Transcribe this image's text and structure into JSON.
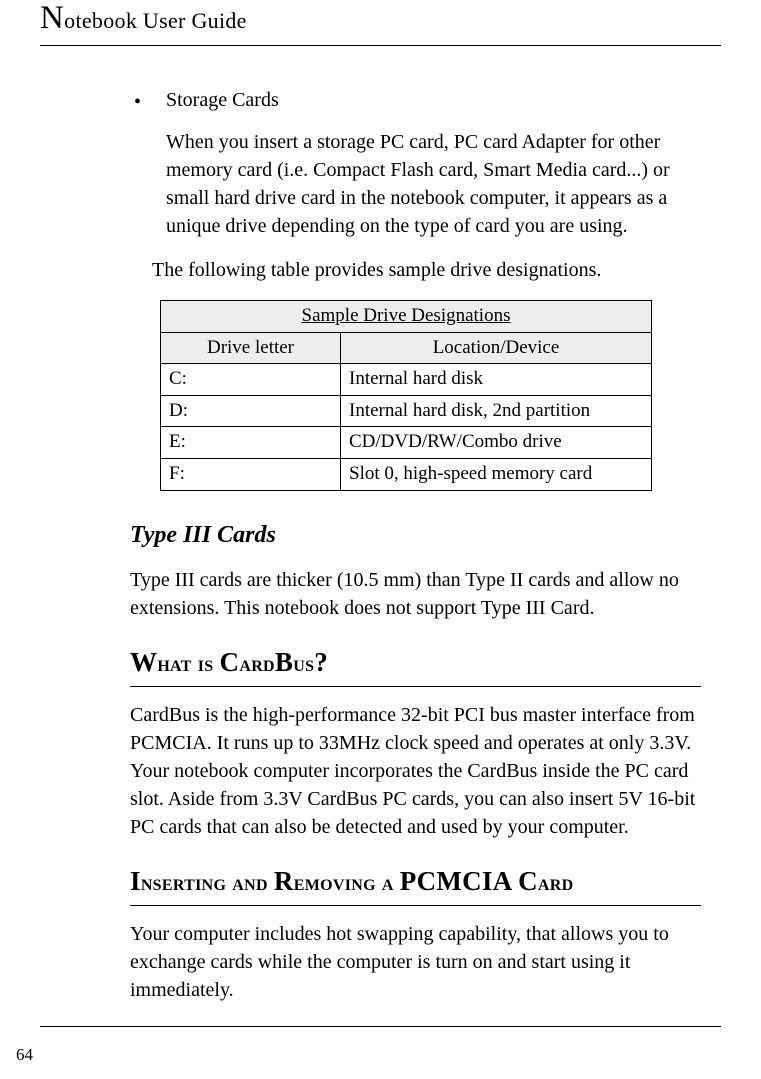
{
  "header": {
    "drop_cap": "N",
    "rest": "otebook User Guide"
  },
  "bullet": {
    "title": "Storage Cards",
    "paragraph": "When you insert a storage PC card, PC card Adapter for other memory card (i.e. Compact Flash card, Smart Media card...) or small hard drive card in the notebook computer, it appears as a unique drive depending on the type of card you are using."
  },
  "table_intro": "The following table provides sample drive designations.",
  "table": {
    "title": "Sample Drive Designations",
    "columns": [
      "Drive letter",
      "Location/Device"
    ],
    "rows": [
      {
        "letter": "C:",
        "device": "Internal hard disk"
      },
      {
        "letter": "D:",
        "device": "Internal hard disk, 2nd partition"
      },
      {
        "letter": "E:",
        "device": "CD/DVD/RW/Combo drive"
      },
      {
        "letter": "F:",
        "device": "Slot 0, high-speed memory card"
      }
    ]
  },
  "type3": {
    "heading": "Type III Cards",
    "paragraph": "Type III cards are thicker (10.5 mm) than Type II cards and allow no extensions. This notebook does not support Type III Card."
  },
  "cardbus": {
    "heading_parts": [
      "W",
      "hat is ",
      "C",
      "ard",
      "B",
      "us",
      "?"
    ],
    "paragraph": "CardBus is the high-performance 32-bit PCI bus master interface from PCMCIA. It runs up to 33MHz clock speed and operates at only 3.3V. Your notebook computer incorporates the CardBus inside the PC card slot. Aside from 3.3V CardBus PC cards, you can also insert 5V 16-bit PC cards that can also be detected and used by your computer."
  },
  "insert": {
    "heading_parts": [
      "I",
      "nserting and ",
      "R",
      "emoving a ",
      "PCMCIA C",
      "ard"
    ],
    "paragraph": "Your computer includes hot swapping capability, that allows you to exchange cards while the computer is turn on and start using it immediately."
  },
  "page_number": "64",
  "chart_data": {
    "type": "table",
    "title": "Sample Drive Designations",
    "columns": [
      "Drive letter",
      "Location/Device"
    ],
    "rows": [
      [
        "C:",
        "Internal hard disk"
      ],
      [
        "D:",
        "Internal hard disk, 2nd partition"
      ],
      [
        "E:",
        "CD/DVD/RW/Combo drive"
      ],
      [
        "F:",
        "Slot 0, high-speed memory card"
      ]
    ]
  }
}
